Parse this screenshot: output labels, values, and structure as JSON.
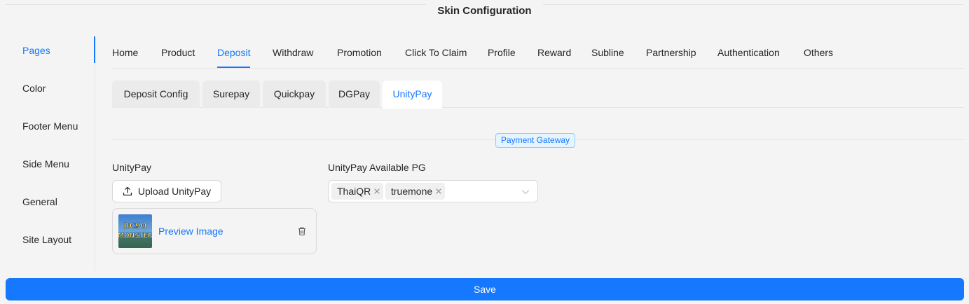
{
  "page": {
    "title": "Skin Configuration"
  },
  "sidebar": {
    "items": [
      {
        "label": "Pages",
        "active": true
      },
      {
        "label": "Color"
      },
      {
        "label": "Footer Menu"
      },
      {
        "label": "Side Menu"
      },
      {
        "label": "General"
      },
      {
        "label": "Site Layout"
      }
    ]
  },
  "tabs": {
    "items": [
      {
        "label": "Home"
      },
      {
        "label": "Product"
      },
      {
        "label": "Deposit",
        "active": true
      },
      {
        "label": "Withdraw"
      },
      {
        "label": "Promotion"
      },
      {
        "label": "Click To Claim"
      },
      {
        "label": "Profile"
      },
      {
        "label": "Reward"
      },
      {
        "label": "Subline"
      },
      {
        "label": "Partnership"
      },
      {
        "label": "Authentication"
      },
      {
        "label": "Others"
      }
    ]
  },
  "subtabs": {
    "items": [
      {
        "label": "Deposit Config"
      },
      {
        "label": "Surepay"
      },
      {
        "label": "Quickpay"
      },
      {
        "label": "DGPay"
      },
      {
        "label": "UnityPay",
        "active": true
      }
    ]
  },
  "section": {
    "divider_label": "Payment Gateway",
    "upload": {
      "label": "UnityPay",
      "button_label": "Upload UnityPay",
      "preview_link": "Preview Image",
      "thumbnail_text": "BC9O MONSTER"
    },
    "available_pg": {
      "label": "UnityPay Available PG",
      "selected": [
        "ThaiQR",
        "truemone"
      ]
    }
  },
  "footer": {
    "save_label": "Save"
  },
  "colors": {
    "accent": "#1677ff",
    "background": "#f4f4f4"
  },
  "icons": {
    "upload": "upload-icon",
    "delete": "trash-icon",
    "remove_tag": "close-icon",
    "dropdown": "chevron-down-icon"
  }
}
